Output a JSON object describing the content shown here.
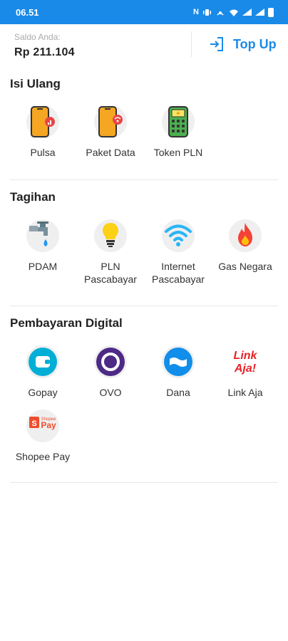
{
  "status_bar": {
    "time": "06.51"
  },
  "balance": {
    "label": "Saldo Anda:",
    "amount": "Rp 211.104",
    "topup_label": "Top Up"
  },
  "sections": {
    "isi_ulang": {
      "title": "Isi Ulang",
      "items": [
        {
          "label": "Pulsa"
        },
        {
          "label": "Paket Data"
        },
        {
          "label": "Token PLN"
        }
      ]
    },
    "tagihan": {
      "title": "Tagihan",
      "items": [
        {
          "label": "PDAM"
        },
        {
          "label": "PLN Pascabayar"
        },
        {
          "label": "Internet Pascabayar"
        },
        {
          "label": "Gas Negara"
        }
      ]
    },
    "pembayaran_digital": {
      "title": "Pembayaran Digital",
      "items": [
        {
          "label": "Gopay"
        },
        {
          "label": "OVO"
        },
        {
          "label": "Dana"
        },
        {
          "label": "Link Aja"
        },
        {
          "label": "Shopee Pay"
        }
      ]
    }
  },
  "logos": {
    "link_aja_top": "Link",
    "link_aja_bottom": "Aja!",
    "shopee_small": "Shopee",
    "shopee_pay": "Pay"
  },
  "colors": {
    "accent": "#1a8ae8",
    "text": "#222222"
  }
}
